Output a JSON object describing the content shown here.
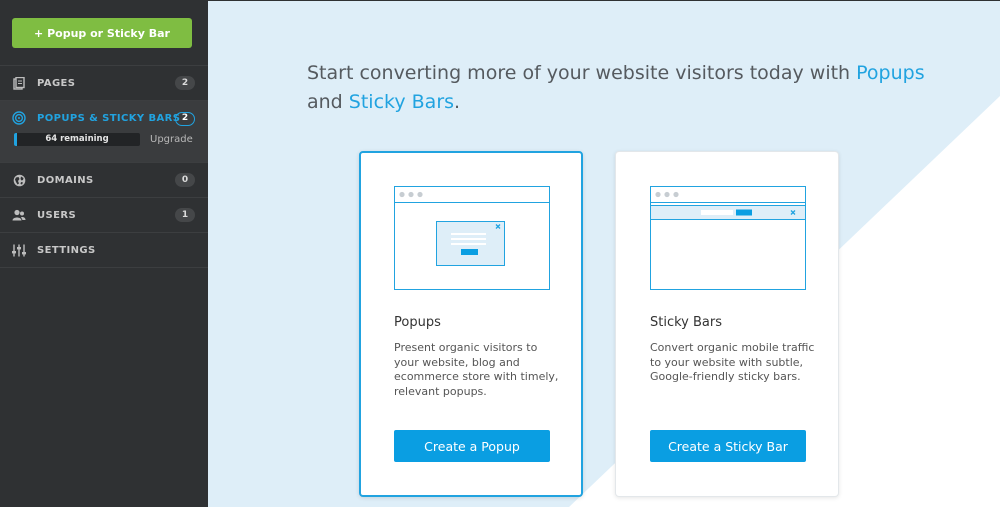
{
  "sidebar": {
    "top_button_label": "+ Popup or Sticky Bar",
    "items": [
      {
        "label": "PAGES",
        "count": "2",
        "icon": "pages-icon"
      },
      {
        "label": "POPUPS & STICKY BARS",
        "count": "2",
        "icon": "target-icon"
      },
      {
        "label": "DOMAINS",
        "count": "0",
        "icon": "globe-icon"
      },
      {
        "label": "USERS",
        "count": "1",
        "icon": "users-icon"
      },
      {
        "label": "SETTINGS",
        "icon": "sliders-icon"
      }
    ],
    "quota": {
      "text": "64 remaining",
      "fraction": 0.02,
      "upgrade_label": "Upgrade"
    }
  },
  "main": {
    "headline_prefix": "Start converting more of your website visitors today with",
    "headline_popups": "Popups",
    "headline_and": "and",
    "headline_sticky": "Sticky Bars",
    "headline_period": ".",
    "cards": [
      {
        "title": "Popups",
        "description": "Present organic visitors to your website, blog and ecommerce store with timely, relevant popups.",
        "button": "Create a Popup"
      },
      {
        "title": "Sticky Bars",
        "description": "Convert organic mobile traffic to your website with subtle, Google-friendly sticky bars.",
        "button": "Create a Sticky Bar"
      }
    ]
  },
  "colors": {
    "accent": "#21a3e0",
    "green": "#7fbd42",
    "sidebar": "#2f3133",
    "bg_light_blue": "#deeef8"
  }
}
